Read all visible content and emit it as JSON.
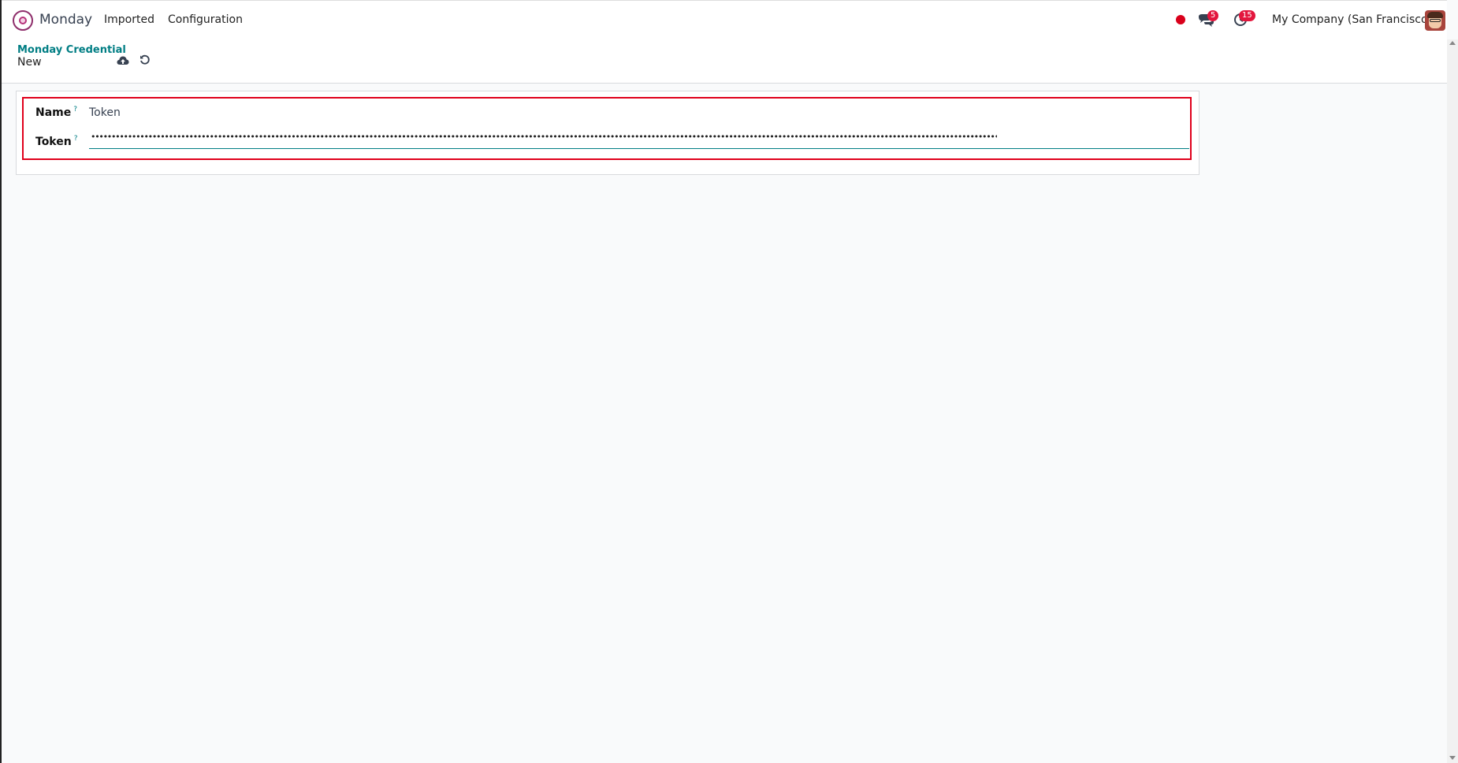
{
  "navbar": {
    "app_name": "Monday",
    "menu": [
      {
        "label": "Imported"
      },
      {
        "label": "Configuration"
      }
    ],
    "chat_badge": "5",
    "activity_badge": "15",
    "company": "My Company (San Francisco)"
  },
  "control_panel": {
    "breadcrumb": "Monday Credential",
    "record_title": "New"
  },
  "form": {
    "name_label": "Name",
    "name_help": "?",
    "name_value": "Token",
    "token_label": "Token",
    "token_help": "?",
    "token_masked": "•••••••••••••••••••••••••••••••••••••••••••••••••••••••••••••••••••••••••••••••••••••••••••••••••••••••••••••••••••••••••••••••••••••••••••••••••••••••••••••••••••••••••••••••••••••••••••••••••••••••••••••••••••••••••••••••••••••••••••••••••••••••••••••••••••••••••••••••••••••••••••••••••"
  },
  "colors": {
    "accent": "#017e84",
    "highlight": "#e0001b",
    "badge": "#e3163d",
    "brand": "#8e2e6b"
  },
  "icons": {
    "app_logo": "monday-app-icon",
    "record": "record-dot-icon",
    "chat": "chat-icon",
    "activity": "clock-activity-icon",
    "save": "cloud-upload-icon",
    "discard": "undo-icon"
  }
}
